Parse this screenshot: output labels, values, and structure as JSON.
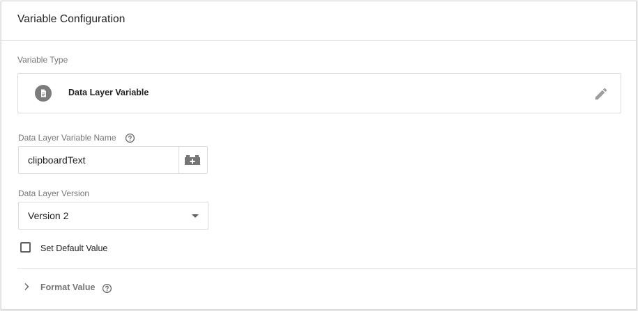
{
  "panel": {
    "title": "Variable Configuration"
  },
  "variable_type": {
    "label": "Variable Type",
    "name": "Data Layer Variable",
    "icon": "document-icon",
    "edit_icon": "pencil-icon"
  },
  "dlv_name": {
    "label": "Data Layer Variable Name",
    "help_icon": "help-circle-icon",
    "value": "clipboardText",
    "picker_icon": "variable-brick-add-icon"
  },
  "dl_version": {
    "label": "Data Layer Version",
    "selected": "Version 2"
  },
  "default_value": {
    "label": "Set Default Value",
    "checked": false
  },
  "format_value": {
    "label": "Format Value",
    "help_icon": "help-circle-icon",
    "expanded": false
  },
  "colors": {
    "text_primary": "#212121",
    "text_secondary": "#757575",
    "border": "#dadce0",
    "icon_grey": "#7b7b7b"
  }
}
